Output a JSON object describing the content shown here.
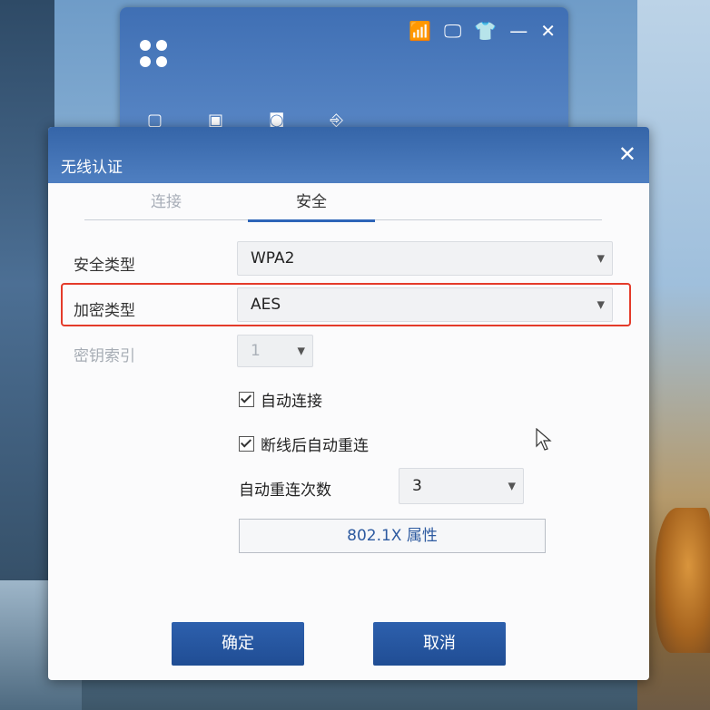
{
  "client": {
    "controls": [
      "📶",
      "🖵",
      "👕",
      "—",
      "✕"
    ],
    "toolbar_glyphs": [
      "▢",
      "▣",
      "◙",
      "⎆"
    ]
  },
  "dialog": {
    "title": "无线认证",
    "close_glyph": "✕",
    "tabs": [
      {
        "label": "连接",
        "active": false
      },
      {
        "label": "安全",
        "active": true
      }
    ],
    "security_type": {
      "label": "安全类型",
      "value": "WPA2"
    },
    "encryption_type": {
      "label": "加密类型",
      "value": "AES"
    },
    "key_index": {
      "label": "密钥索引",
      "value": "1"
    },
    "auto_connect": {
      "label": "自动连接",
      "checked": true
    },
    "auto_reconnect": {
      "label": "断线后自动重连",
      "checked": true
    },
    "reconnect_count": {
      "label": "自动重连次数",
      "value": "3"
    },
    "dot1x_button": "802.1X 属性",
    "ok_button": "确定",
    "cancel_button": "取消"
  },
  "colors": {
    "titlebar": "#3565a8",
    "accent": "#2d64b8",
    "highlight": "#e43b2a"
  }
}
